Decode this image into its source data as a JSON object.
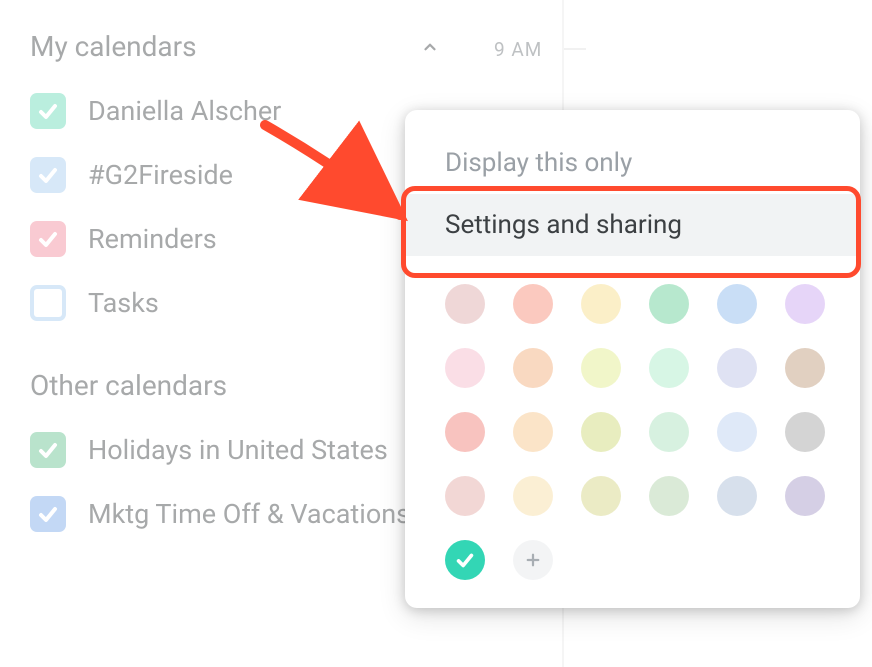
{
  "sidebar": {
    "my_calendars_title": "My calendars",
    "other_calendars_title": "Other calendars",
    "my_calendars": [
      {
        "label": "Daniella Alscher",
        "color": "#67d9b6",
        "checked": true
      },
      {
        "label": "#G2Fireside",
        "color": "#a6cdef",
        "checked": true
      },
      {
        "label": "Reminders",
        "color": "#f28b9b",
        "checked": true
      },
      {
        "label": "Tasks",
        "color": "#a6cdef",
        "checked": false
      }
    ],
    "other_calendars": [
      {
        "label": "Holidays in United States",
        "color": "#64c18f",
        "checked": true
      },
      {
        "label": "Mktg Time Off & Vacations",
        "color": "#7ba8e8",
        "checked": true
      }
    ]
  },
  "time": {
    "label": "9 AM"
  },
  "popover": {
    "display_only": "Display this only",
    "settings_sharing": "Settings and sharing",
    "swatches": [
      "#e2b7b7",
      "#f79d8a",
      "#f7e19a",
      "#7cd6a5",
      "#9cc3ef",
      "#d2b2f2",
      "#f5c2d2",
      "#f4b98e",
      "#e6ee9c",
      "#b6efcf",
      "#c5cae9",
      "#c8a98e",
      "#f2918a",
      "#f7cd9a",
      "#d6df8a",
      "#b6e6c6",
      "#c4d7f2",
      "#b0b0b0",
      "#e8b7b2",
      "#f7e2b0",
      "#dada95",
      "#bcd9b6",
      "#b7c6dc",
      "#b3a8d0"
    ],
    "selected_swatch": "#33d6b5"
  }
}
